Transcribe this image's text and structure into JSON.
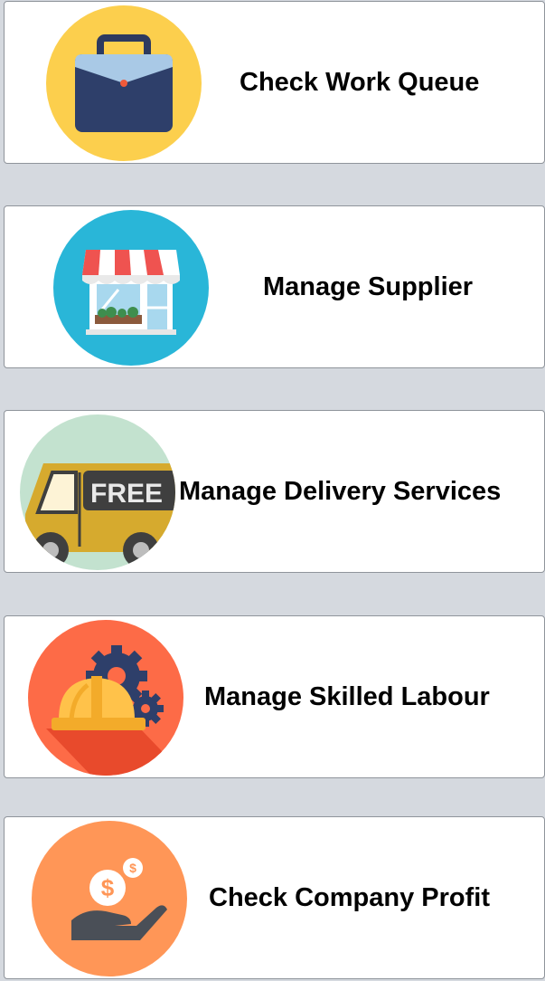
{
  "tiles": [
    {
      "label": "Check Work Queue",
      "icon": "briefcase-icon"
    },
    {
      "label": "Manage Supplier",
      "icon": "storefront-icon"
    },
    {
      "label": "Manage Delivery Services",
      "icon": "delivery-truck-icon",
      "badge": "FREE"
    },
    {
      "label": "Manage Skilled Labour",
      "icon": "hardhat-gears-icon"
    },
    {
      "label": "Check Company Profit",
      "icon": "money-hand-icon",
      "coin_symbol": "$"
    }
  ],
  "colors": {
    "background": "#d5d9df",
    "tile": "#ffffff",
    "tile_border": "#8f949b",
    "briefcase_circle": "#fccf4d",
    "supplier_circle": "#29b6d8",
    "delivery_circle": "#c3e2cf",
    "labour_circle": "#fd6b47",
    "profit_circle": "#ff9657"
  }
}
